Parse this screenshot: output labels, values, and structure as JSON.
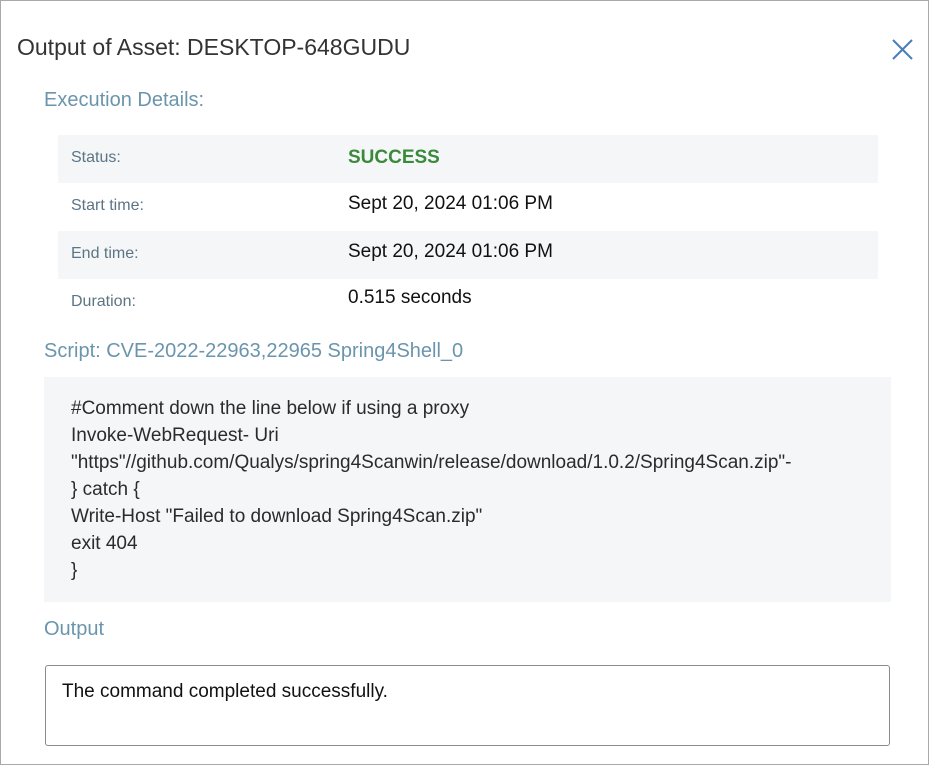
{
  "dialog": {
    "title_prefix": "Output of Asset: ",
    "asset_name": "DESKTOP-648GUDU",
    "close_icon": "close-icon"
  },
  "execution_details": {
    "heading": "Execution Details:",
    "rows": [
      {
        "label": "Status",
        "separator": ":",
        "value": "SUCCESS"
      },
      {
        "label": "Start time",
        "separator": ":",
        "value": "Sept 20, 2024 01:06 PM"
      },
      {
        "label": "End time",
        "separator": ":",
        "value": "Sept 20, 2024 01:06 PM"
      },
      {
        "label": "Duration",
        "separator": ":",
        "value": "0.515 seconds"
      }
    ],
    "colors": {
      "success": "#3b8a3b"
    }
  },
  "script": {
    "heading": "Script: CVE-2022-22963,22965 Spring4Shell_0",
    "lines": [
      "#Comment down the line below if using a proxy",
      "Invoke-WebRequest- Uri",
      "\"https\"//github.com/Qualys/spring4Scanwin/release/download/1.0.2/Spring4Scan.zip\"-",
      "} catch {",
      "Write-Host \"Failed to download Spring4Scan.zip\"",
      "exit 404",
      "}"
    ]
  },
  "output": {
    "heading": "Output",
    "text": "The command completed successfully."
  },
  "theme": {
    "accent": "#6a95ad",
    "close": "#4a7fb5"
  }
}
